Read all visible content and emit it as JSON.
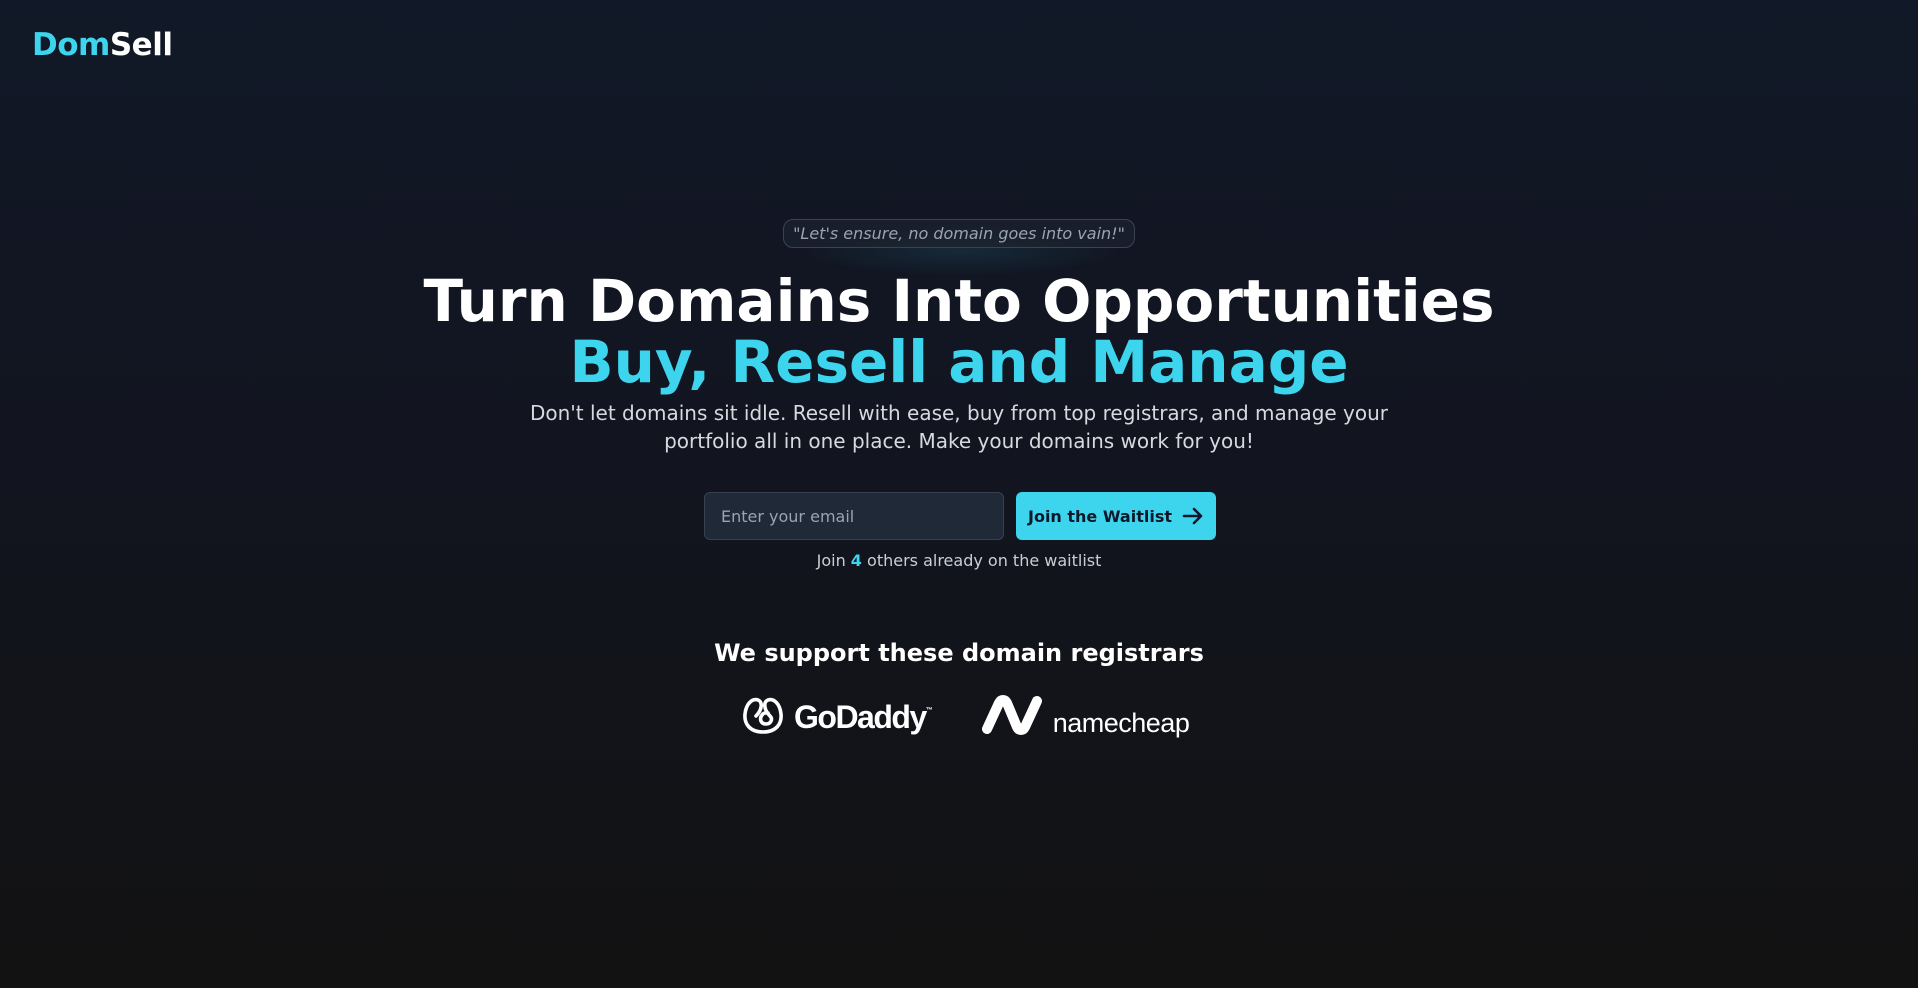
{
  "brand": {
    "logo_part1": "Dom",
    "logo_part2": "Sell",
    "accent_color": "#3dd5ee"
  },
  "hero": {
    "quote": "\"Let's ensure, no domain goes into vain!\"",
    "headline": "Turn Domains Into Opportunities",
    "subheadline": "Buy, Resell and Manage",
    "description": "Don't let domains sit idle. Resell with ease, buy from top registrars, and manage your portfolio all in one place. Make your domains work for you!"
  },
  "waitlist": {
    "email_placeholder": "Enter your email",
    "email_value": "",
    "button_label": "Join the Waitlist",
    "button_icon": "arrow-right-icon",
    "count_prefix": "Join",
    "count": "4",
    "count_suffix": "others already on the waitlist"
  },
  "registrars": {
    "title": "We support these domain registrars",
    "items": [
      {
        "name": "GoDaddy",
        "icon": "godaddy-logo-icon",
        "trademark": "™"
      },
      {
        "name": "namecheap",
        "icon": "namecheap-logo-icon"
      }
    ]
  },
  "colors": {
    "background_top": "#111827",
    "background_bottom": "#121212",
    "button_bg": "#3dd5ee",
    "input_bg": "#1f2937"
  }
}
